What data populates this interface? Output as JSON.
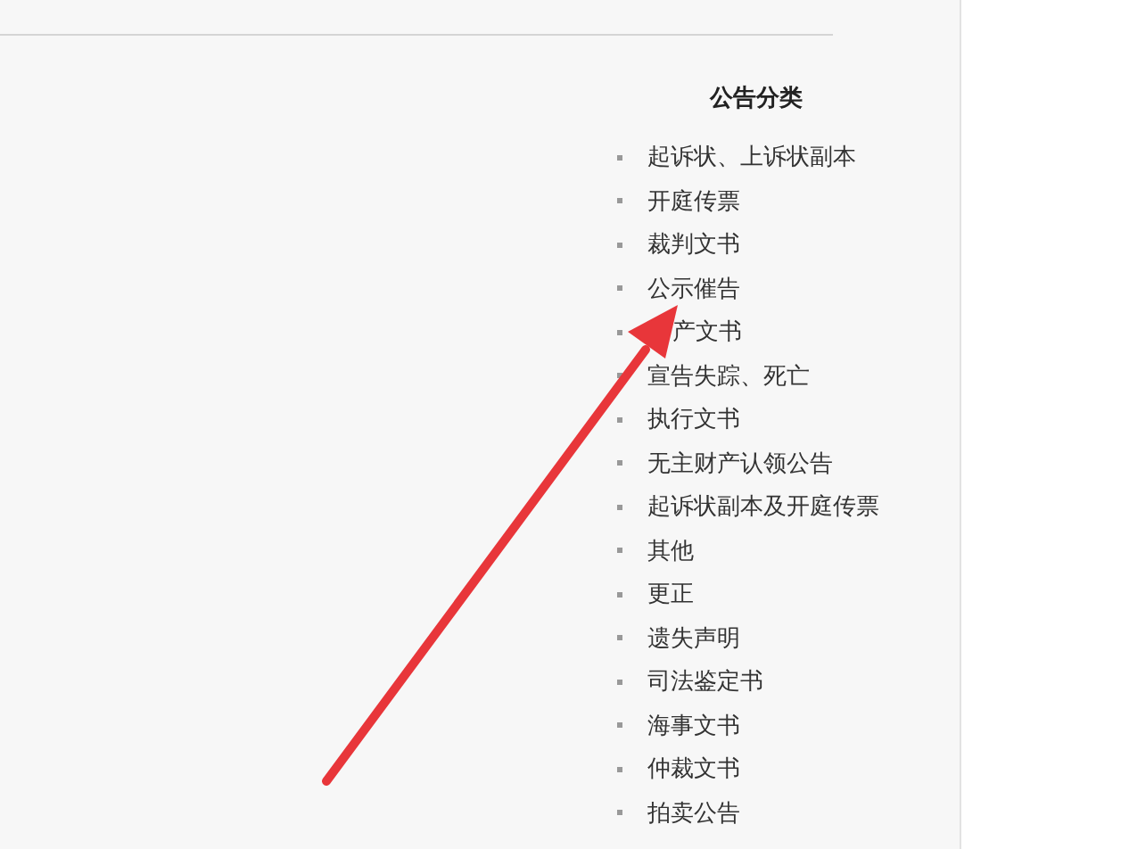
{
  "sidebar": {
    "title": "公告分类",
    "items": [
      {
        "label": "起诉状、上诉状副本"
      },
      {
        "label": "开庭传票"
      },
      {
        "label": "裁判文书"
      },
      {
        "label": "公示催告"
      },
      {
        "label": "产文书",
        "kind": "covered"
      },
      {
        "label": "宣告失踪、死亡"
      },
      {
        "label": "执行文书"
      },
      {
        "label": "无主财产认领公告"
      },
      {
        "label": "起诉状副本及开庭传票"
      },
      {
        "label": "其他"
      },
      {
        "label": "更正"
      },
      {
        "label": "遗失声明"
      },
      {
        "label": "司法鉴定书"
      },
      {
        "label": "海事文书"
      },
      {
        "label": "仲裁文书"
      },
      {
        "label": "拍卖公告"
      }
    ]
  }
}
